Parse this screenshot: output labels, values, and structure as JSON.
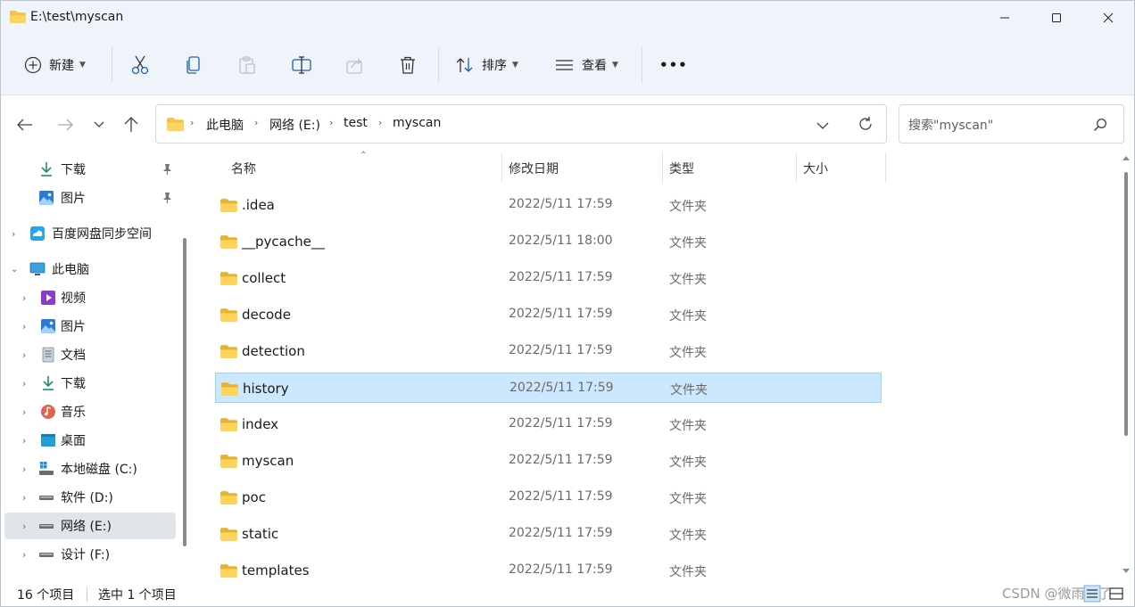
{
  "window": {
    "title": "E:\\test\\myscan"
  },
  "toolbar": {
    "new_label": "新建",
    "sort_label": "排序",
    "view_label": "查看",
    "more_label": "•••"
  },
  "address": {
    "crumbs": [
      "此电脑",
      "网络 (E:)",
      "test",
      "myscan"
    ],
    "search_placeholder": "搜索\"myscan\""
  },
  "sidebar": {
    "items": [
      {
        "label": "下载",
        "icon": "download-icon",
        "pinned": true
      },
      {
        "label": "图片",
        "icon": "pictures-icon",
        "pinned": true
      },
      {
        "label": "百度网盘同步空间",
        "icon": "baidu-cloud-icon"
      },
      {
        "label": "此电脑",
        "icon": "computer-icon",
        "expanded": true
      },
      {
        "label": "视频",
        "icon": "videos-icon"
      },
      {
        "label": "图片",
        "icon": "pictures-icon"
      },
      {
        "label": "文档",
        "icon": "documents-icon"
      },
      {
        "label": "下载",
        "icon": "download-icon"
      },
      {
        "label": "音乐",
        "icon": "music-icon"
      },
      {
        "label": "桌面",
        "icon": "desktop-icon"
      },
      {
        "label": "本地磁盘 (C:)",
        "icon": "windows-drive-icon"
      },
      {
        "label": "软件 (D:)",
        "icon": "drive-icon"
      },
      {
        "label": "网络 (E:)",
        "icon": "drive-icon",
        "selected": true
      },
      {
        "label": "设计 (F:)",
        "icon": "drive-icon"
      }
    ]
  },
  "columns": {
    "name": "名称",
    "date": "修改日期",
    "type": "类型",
    "size": "大小"
  },
  "files": [
    {
      "name": ".idea",
      "date": "2022/5/11 17:59",
      "type": "文件夹"
    },
    {
      "name": "__pycache__",
      "date": "2022/5/11 18:00",
      "type": "文件夹"
    },
    {
      "name": "collect",
      "date": "2022/5/11 17:59",
      "type": "文件夹"
    },
    {
      "name": "decode",
      "date": "2022/5/11 17:59",
      "type": "文件夹"
    },
    {
      "name": "detection",
      "date": "2022/5/11 17:59",
      "type": "文件夹"
    },
    {
      "name": "history",
      "date": "2022/5/11 17:59",
      "type": "文件夹",
      "selected": true
    },
    {
      "name": "index",
      "date": "2022/5/11 17:59",
      "type": "文件夹"
    },
    {
      "name": "myscan",
      "date": "2022/5/11 17:59",
      "type": "文件夹"
    },
    {
      "name": "poc",
      "date": "2022/5/11 17:59",
      "type": "文件夹"
    },
    {
      "name": "static",
      "date": "2022/5/11 17:59",
      "type": "文件夹"
    },
    {
      "name": "templates",
      "date": "2022/5/11 17:59",
      "type": "文件夹"
    }
  ],
  "status": {
    "item_count": "16 个项目",
    "selected_count": "选中 1 个项目",
    "watermark": "CSDN @微雨停了"
  },
  "colors": {
    "chrome_bg": "#eef4f9",
    "selected_row": "#cce8ff",
    "folder": "#f5c343"
  }
}
